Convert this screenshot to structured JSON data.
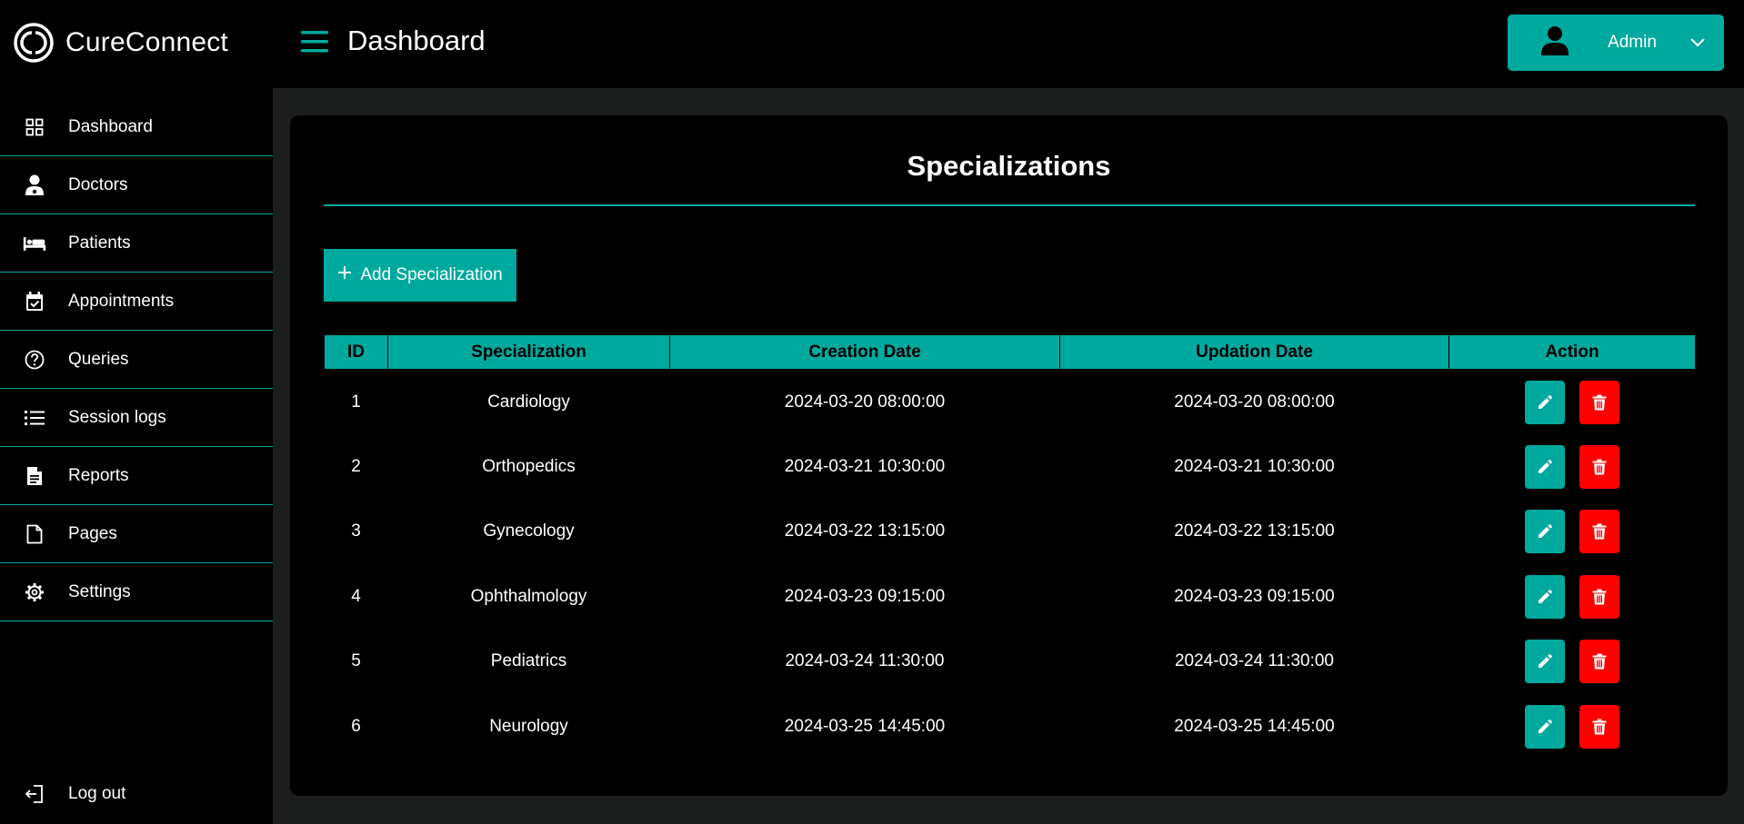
{
  "app": {
    "name": "CureConnect"
  },
  "header": {
    "title": "Dashboard",
    "user": "Admin"
  },
  "sidebar": {
    "items": [
      {
        "label": "Dashboard",
        "icon": "grid-icon"
      },
      {
        "label": "Doctors",
        "icon": "doctor-icon"
      },
      {
        "label": "Patients",
        "icon": "bed-icon"
      },
      {
        "label": "Appointments",
        "icon": "calendar-check-icon"
      },
      {
        "label": "Queries",
        "icon": "question-icon"
      },
      {
        "label": "Session logs",
        "icon": "list-icon"
      },
      {
        "label": "Reports",
        "icon": "report-icon"
      },
      {
        "label": "Pages",
        "icon": "file-icon"
      },
      {
        "label": "Settings",
        "icon": "gear-icon"
      }
    ],
    "logout": "Log out"
  },
  "main": {
    "title": "Specializations",
    "add_button": "Add Specialization",
    "table": {
      "columns": [
        "ID",
        "Specialization",
        "Creation Date",
        "Updation Date",
        "Action"
      ],
      "rows": [
        {
          "id": "1",
          "name": "Cardiology",
          "created": "2024-03-20 08:00:00",
          "updated": "2024-03-20 08:00:00"
        },
        {
          "id": "2",
          "name": "Orthopedics",
          "created": "2024-03-21 10:30:00",
          "updated": "2024-03-21 10:30:00"
        },
        {
          "id": "3",
          "name": "Gynecology",
          "created": "2024-03-22 13:15:00",
          "updated": "2024-03-22 13:15:00"
        },
        {
          "id": "4",
          "name": "Ophthalmology",
          "created": "2024-03-23 09:15:00",
          "updated": "2024-03-23 09:15:00"
        },
        {
          "id": "5",
          "name": "Pediatrics",
          "created": "2024-03-24 11:30:00",
          "updated": "2024-03-24 11:30:00"
        },
        {
          "id": "6",
          "name": "Neurology",
          "created": "2024-03-25 14:45:00",
          "updated": "2024-03-25 14:45:00"
        }
      ]
    }
  },
  "colors": {
    "accent": "#00a99d",
    "danger": "#ff0000",
    "background": "#000000",
    "panel": "#1c1e1e"
  }
}
